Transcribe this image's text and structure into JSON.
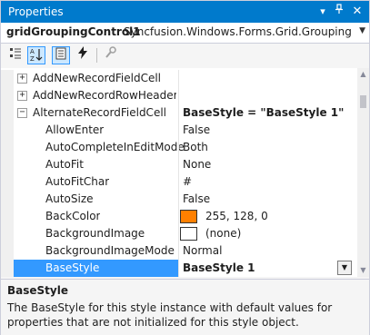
{
  "window": {
    "title": "Properties"
  },
  "titlebar_icons": {
    "pin": "pin-icon",
    "dropdown": "dropdown-arrow-icon",
    "close": "close-icon"
  },
  "object_selector": {
    "name": "gridGroupingControl1",
    "type": "Syncfusion.Windows.Forms.Grid.Grouping.GridC"
  },
  "toolbar": [
    "categorized-icon",
    "alphabetical-icon",
    "properties-icon",
    "events-icon",
    "property-pages-icon"
  ],
  "rows": [
    {
      "name": "AddNewRecordFieldCell",
      "value": "",
      "expander": "+"
    },
    {
      "name": "AddNewRecordRowHeaderCe",
      "value": "",
      "expander": "+"
    },
    {
      "name": "AlternateRecordFieldCell",
      "value": "BaseStyle = \"BaseStyle 1\"",
      "expander": "−"
    },
    {
      "name": "AllowEnter",
      "value": "False"
    },
    {
      "name": "AutoCompleteInEditMode",
      "value": "Both"
    },
    {
      "name": "AutoFit",
      "value": "None"
    },
    {
      "name": "AutoFitChar",
      "value": "#"
    },
    {
      "name": "AutoSize",
      "value": "False"
    },
    {
      "name": "BackColor",
      "value": "255, 128, 0",
      "swatch": "#ff8000"
    },
    {
      "name": "BackgroundImage",
      "value": "(none)",
      "swatch": "#ffffff"
    },
    {
      "name": "BackgroundImageMode",
      "value": "Normal"
    },
    {
      "name": "BaseStyle",
      "value": "BaseStyle 1"
    }
  ],
  "description": {
    "title": "BaseStyle",
    "text": "The BaseStyle for this style instance with default values for properties that are not initialized for this style object."
  },
  "colors": {
    "accent": "#007acc",
    "selection": "#3399ff"
  }
}
